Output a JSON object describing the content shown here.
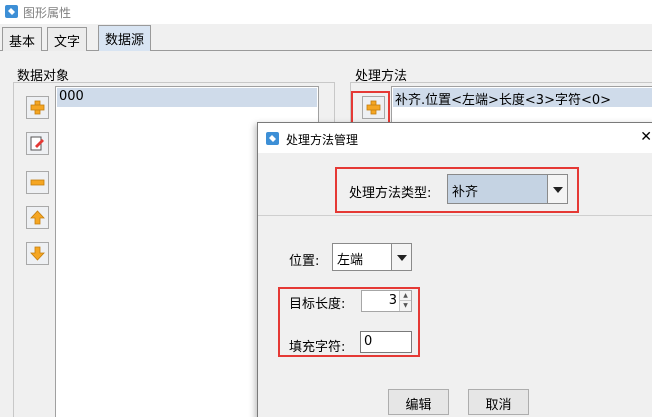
{
  "window": {
    "title": "图形属性"
  },
  "tabs": [
    {
      "label": "基本",
      "active": false
    },
    {
      "label": "文字",
      "active": false
    },
    {
      "label": "数据源",
      "active": true
    }
  ],
  "data_objects": {
    "label": "数据对象",
    "items": [
      "000"
    ],
    "buttons": [
      "add-icon",
      "edit-icon",
      "remove-icon",
      "move-up-icon",
      "move-down-icon"
    ]
  },
  "methods": {
    "label": "处理方法",
    "items": [
      "补齐.位置<左端>长度<3>字符<0>"
    ]
  },
  "dialog": {
    "title": "处理方法管理",
    "close": "✕",
    "type_label": "处理方法类型:",
    "type_value": "补齐",
    "position_label": "位置:",
    "position_value": "左端",
    "length_label": "目标长度:",
    "length_value": "3",
    "fill_label": "填充字符:",
    "fill_value": "0",
    "edit_button": "编辑",
    "cancel_button": "取消"
  },
  "colors": {
    "accent": "#e53935",
    "selection": "#cfdbea",
    "icon_orange": "#f5a623"
  }
}
